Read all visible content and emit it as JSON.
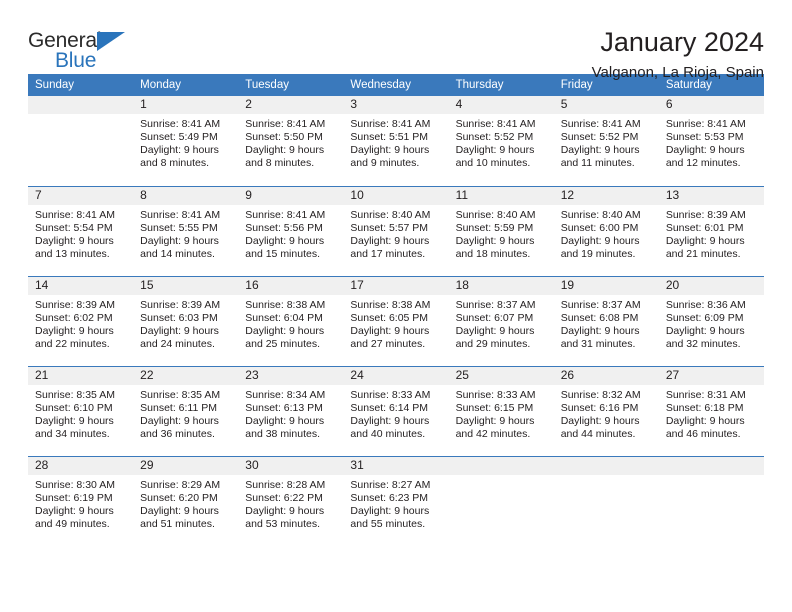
{
  "brand": {
    "name_top": "General",
    "name_bottom": "Blue",
    "triangle_color": "#2a74bb"
  },
  "header": {
    "title": "January 2024",
    "subtitle": "Valganon, La Rioja, Spain"
  },
  "theme": {
    "header_blue": "#3a79bc",
    "daynum_gray": "#f0f0f0",
    "text": "#231f20"
  },
  "weekday_headers": [
    "Sunday",
    "Monday",
    "Tuesday",
    "Wednesday",
    "Thursday",
    "Friday",
    "Saturday"
  ],
  "weeks": [
    [
      {
        "day": "",
        "lines": []
      },
      {
        "day": "1",
        "lines": [
          "Sunrise: 8:41 AM",
          "Sunset: 5:49 PM",
          "Daylight: 9 hours",
          "and 8 minutes."
        ]
      },
      {
        "day": "2",
        "lines": [
          "Sunrise: 8:41 AM",
          "Sunset: 5:50 PM",
          "Daylight: 9 hours",
          "and 8 minutes."
        ]
      },
      {
        "day": "3",
        "lines": [
          "Sunrise: 8:41 AM",
          "Sunset: 5:51 PM",
          "Daylight: 9 hours",
          "and 9 minutes."
        ]
      },
      {
        "day": "4",
        "lines": [
          "Sunrise: 8:41 AM",
          "Sunset: 5:52 PM",
          "Daylight: 9 hours",
          "and 10 minutes."
        ]
      },
      {
        "day": "5",
        "lines": [
          "Sunrise: 8:41 AM",
          "Sunset: 5:52 PM",
          "Daylight: 9 hours",
          "and 11 minutes."
        ]
      },
      {
        "day": "6",
        "lines": [
          "Sunrise: 8:41 AM",
          "Sunset: 5:53 PM",
          "Daylight: 9 hours",
          "and 12 minutes."
        ]
      }
    ],
    [
      {
        "day": "7",
        "lines": [
          "Sunrise: 8:41 AM",
          "Sunset: 5:54 PM",
          "Daylight: 9 hours",
          "and 13 minutes."
        ]
      },
      {
        "day": "8",
        "lines": [
          "Sunrise: 8:41 AM",
          "Sunset: 5:55 PM",
          "Daylight: 9 hours",
          "and 14 minutes."
        ]
      },
      {
        "day": "9",
        "lines": [
          "Sunrise: 8:41 AM",
          "Sunset: 5:56 PM",
          "Daylight: 9 hours",
          "and 15 minutes."
        ]
      },
      {
        "day": "10",
        "lines": [
          "Sunrise: 8:40 AM",
          "Sunset: 5:57 PM",
          "Daylight: 9 hours",
          "and 17 minutes."
        ]
      },
      {
        "day": "11",
        "lines": [
          "Sunrise: 8:40 AM",
          "Sunset: 5:59 PM",
          "Daylight: 9 hours",
          "and 18 minutes."
        ]
      },
      {
        "day": "12",
        "lines": [
          "Sunrise: 8:40 AM",
          "Sunset: 6:00 PM",
          "Daylight: 9 hours",
          "and 19 minutes."
        ]
      },
      {
        "day": "13",
        "lines": [
          "Sunrise: 8:39 AM",
          "Sunset: 6:01 PM",
          "Daylight: 9 hours",
          "and 21 minutes."
        ]
      }
    ],
    [
      {
        "day": "14",
        "lines": [
          "Sunrise: 8:39 AM",
          "Sunset: 6:02 PM",
          "Daylight: 9 hours",
          "and 22 minutes."
        ]
      },
      {
        "day": "15",
        "lines": [
          "Sunrise: 8:39 AM",
          "Sunset: 6:03 PM",
          "Daylight: 9 hours",
          "and 24 minutes."
        ]
      },
      {
        "day": "16",
        "lines": [
          "Sunrise: 8:38 AM",
          "Sunset: 6:04 PM",
          "Daylight: 9 hours",
          "and 25 minutes."
        ]
      },
      {
        "day": "17",
        "lines": [
          "Sunrise: 8:38 AM",
          "Sunset: 6:05 PM",
          "Daylight: 9 hours",
          "and 27 minutes."
        ]
      },
      {
        "day": "18",
        "lines": [
          "Sunrise: 8:37 AM",
          "Sunset: 6:07 PM",
          "Daylight: 9 hours",
          "and 29 minutes."
        ]
      },
      {
        "day": "19",
        "lines": [
          "Sunrise: 8:37 AM",
          "Sunset: 6:08 PM",
          "Daylight: 9 hours",
          "and 31 minutes."
        ]
      },
      {
        "day": "20",
        "lines": [
          "Sunrise: 8:36 AM",
          "Sunset: 6:09 PM",
          "Daylight: 9 hours",
          "and 32 minutes."
        ]
      }
    ],
    [
      {
        "day": "21",
        "lines": [
          "Sunrise: 8:35 AM",
          "Sunset: 6:10 PM",
          "Daylight: 9 hours",
          "and 34 minutes."
        ]
      },
      {
        "day": "22",
        "lines": [
          "Sunrise: 8:35 AM",
          "Sunset: 6:11 PM",
          "Daylight: 9 hours",
          "and 36 minutes."
        ]
      },
      {
        "day": "23",
        "lines": [
          "Sunrise: 8:34 AM",
          "Sunset: 6:13 PM",
          "Daylight: 9 hours",
          "and 38 minutes."
        ]
      },
      {
        "day": "24",
        "lines": [
          "Sunrise: 8:33 AM",
          "Sunset: 6:14 PM",
          "Daylight: 9 hours",
          "and 40 minutes."
        ]
      },
      {
        "day": "25",
        "lines": [
          "Sunrise: 8:33 AM",
          "Sunset: 6:15 PM",
          "Daylight: 9 hours",
          "and 42 minutes."
        ]
      },
      {
        "day": "26",
        "lines": [
          "Sunrise: 8:32 AM",
          "Sunset: 6:16 PM",
          "Daylight: 9 hours",
          "and 44 minutes."
        ]
      },
      {
        "day": "27",
        "lines": [
          "Sunrise: 8:31 AM",
          "Sunset: 6:18 PM",
          "Daylight: 9 hours",
          "and 46 minutes."
        ]
      }
    ],
    [
      {
        "day": "28",
        "lines": [
          "Sunrise: 8:30 AM",
          "Sunset: 6:19 PM",
          "Daylight: 9 hours",
          "and 49 minutes."
        ]
      },
      {
        "day": "29",
        "lines": [
          "Sunrise: 8:29 AM",
          "Sunset: 6:20 PM",
          "Daylight: 9 hours",
          "and 51 minutes."
        ]
      },
      {
        "day": "30",
        "lines": [
          "Sunrise: 8:28 AM",
          "Sunset: 6:22 PM",
          "Daylight: 9 hours",
          "and 53 minutes."
        ]
      },
      {
        "day": "31",
        "lines": [
          "Sunrise: 8:27 AM",
          "Sunset: 6:23 PM",
          "Daylight: 9 hours",
          "and 55 minutes."
        ]
      },
      {
        "day": "",
        "lines": []
      },
      {
        "day": "",
        "lines": []
      },
      {
        "day": "",
        "lines": []
      }
    ]
  ]
}
